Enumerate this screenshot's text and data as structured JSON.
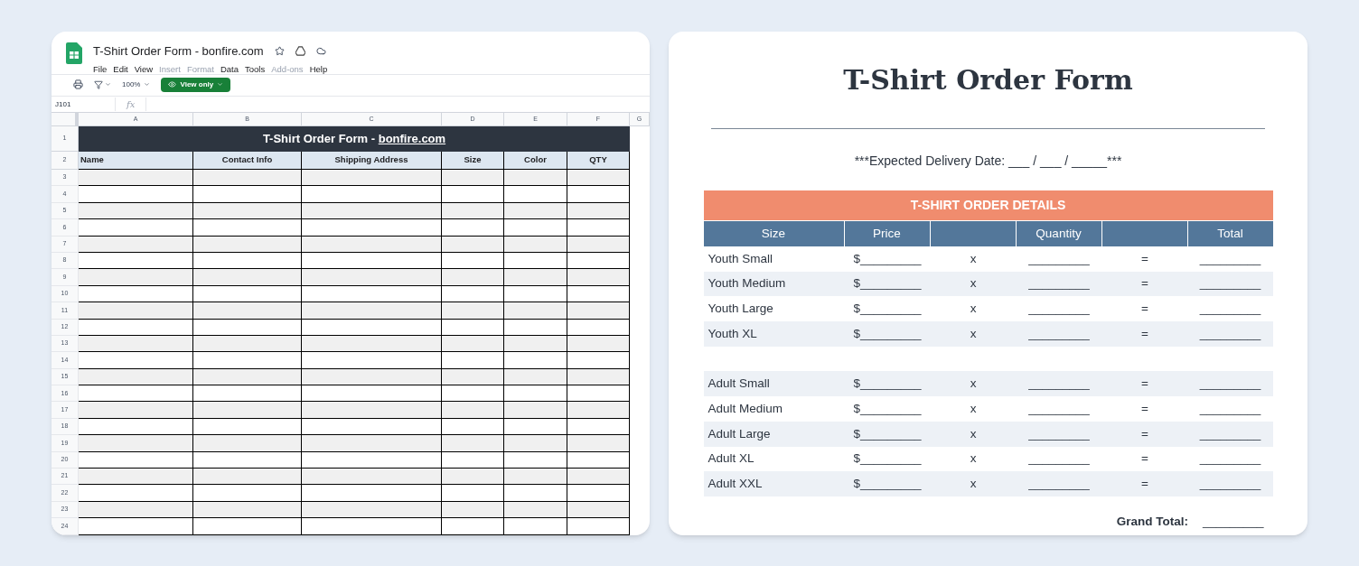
{
  "sheet": {
    "title": "T-Shirt Order Form - bonfire.com",
    "menu": [
      {
        "label": "File",
        "disabled": false
      },
      {
        "label": "Edit",
        "disabled": false
      },
      {
        "label": "View",
        "disabled": false
      },
      {
        "label": "Insert",
        "disabled": true
      },
      {
        "label": "Format",
        "disabled": true
      },
      {
        "label": "Data",
        "disabled": false
      },
      {
        "label": "Tools",
        "disabled": false
      },
      {
        "label": "Add-ons",
        "disabled": true
      },
      {
        "label": "Help",
        "disabled": false
      }
    ],
    "zoom": "100%",
    "view_mode": "View only",
    "cell_ref": "J101",
    "fx": "fx",
    "columns": [
      "A",
      "B",
      "C",
      "D",
      "E",
      "F",
      "G"
    ],
    "banner": {
      "number": "1",
      "text": "T-Shirt Order Form - ",
      "link": "bonfire.com"
    },
    "header_row": {
      "number": "2",
      "cells": [
        "Name",
        "Contact Info",
        "Shipping Address",
        "Size",
        "Color",
        "QTY"
      ]
    },
    "rows": [
      "3",
      "4",
      "5",
      "6",
      "7",
      "8",
      "9",
      "10",
      "11",
      "12",
      "13",
      "14",
      "15",
      "16",
      "17",
      "18",
      "19",
      "20",
      "21",
      "22",
      "23",
      "24"
    ]
  },
  "form": {
    "title": "T-Shirt Order Form",
    "delivery": "***Expected Delivery Date: ___ / ___ / _____***",
    "section_title": "T-SHIRT ORDER DETAILS",
    "columns": [
      "Size",
      "Price",
      "",
      "Quantity",
      "",
      "Total"
    ],
    "groups": [
      [
        {
          "size": "Youth Small",
          "price": "$_________",
          "times": "x",
          "quantity": "_________",
          "equals": "=",
          "total": "_________"
        },
        {
          "size": "Youth Medium",
          "price": "$_________",
          "times": "x",
          "quantity": "_________",
          "equals": "=",
          "total": "_________"
        },
        {
          "size": "Youth Large",
          "price": "$_________",
          "times": "x",
          "quantity": "_________",
          "equals": "=",
          "total": "_________"
        },
        {
          "size": "Youth XL",
          "price": "$_________",
          "times": "x",
          "quantity": "_________",
          "equals": "=",
          "total": "_________"
        }
      ],
      [
        {
          "size": "Adult Small",
          "price": "$_________",
          "times": "x",
          "quantity": "_________",
          "equals": "=",
          "total": "_________"
        },
        {
          "size": "Adult Medium",
          "price": "$_________",
          "times": "x",
          "quantity": "_________",
          "equals": "=",
          "total": "_________"
        },
        {
          "size": "Adult Large",
          "price": "$_________",
          "times": "x",
          "quantity": "_________",
          "equals": "=",
          "total": "_________"
        },
        {
          "size": "Adult XL",
          "price": "$_________",
          "times": "x",
          "quantity": "_________",
          "equals": "=",
          "total": "_________"
        },
        {
          "size": "Adult XXL",
          "price": "$_________",
          "times": "x",
          "quantity": "_________",
          "equals": "=",
          "total": "_________"
        }
      ]
    ],
    "grand_total_label": "Grand Total:",
    "grand_total": "_________"
  }
}
